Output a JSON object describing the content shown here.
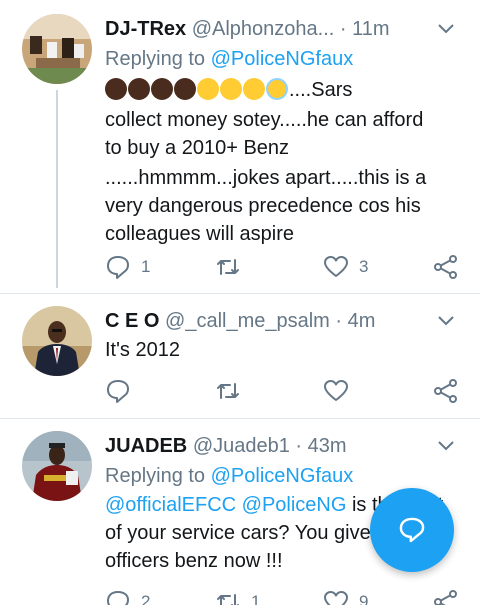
{
  "tweets": [
    {
      "name": "DJ-TRex",
      "handle": "@Alphonzoha...",
      "dot": "·",
      "time": "11m",
      "replying_prefix": "Replying to",
      "replying_to": "@PoliceNGfaux",
      "emoji_suffix": "....Sars",
      "body_lines": [
        "collect money sotey.....he can afford",
        "to buy a 2010+ Benz",
        "......hmmmm...jokes apart.....this is a",
        "very dangerous precedence cos his",
        "colleagues will aspire"
      ],
      "reply_count": "1",
      "retweet_count": "",
      "like_count": "3"
    },
    {
      "name": "C E O",
      "handle": "@_call_me_psalm",
      "dot": "·",
      "time": "4m",
      "body": "It's 2012",
      "reply_count": "",
      "retweet_count": "",
      "like_count": ""
    },
    {
      "name": "JUADEB",
      "handle": "@Juadeb1",
      "dot": "·",
      "time": "43m",
      "replying_prefix": "Replying to",
      "replying_to": "@PoliceNGfaux",
      "mention1": "@officialEFCC",
      "mention2": "@PoliceNG",
      "line1_text": " is this part",
      "line2": "of your service cars? You give",
      "line3": "officers benz now !!!",
      "reply_count": "2",
      "retweet_count": "1",
      "like_count": "9"
    }
  ],
  "icons": {
    "reply": "reply-icon",
    "retweet": "retweet-icon",
    "like": "heart-icon",
    "share": "share-icon",
    "compose": "compose-reply-icon"
  },
  "colors": {
    "link": "#1da1f2",
    "secondary": "#657786",
    "fab": "#1da1f2"
  }
}
